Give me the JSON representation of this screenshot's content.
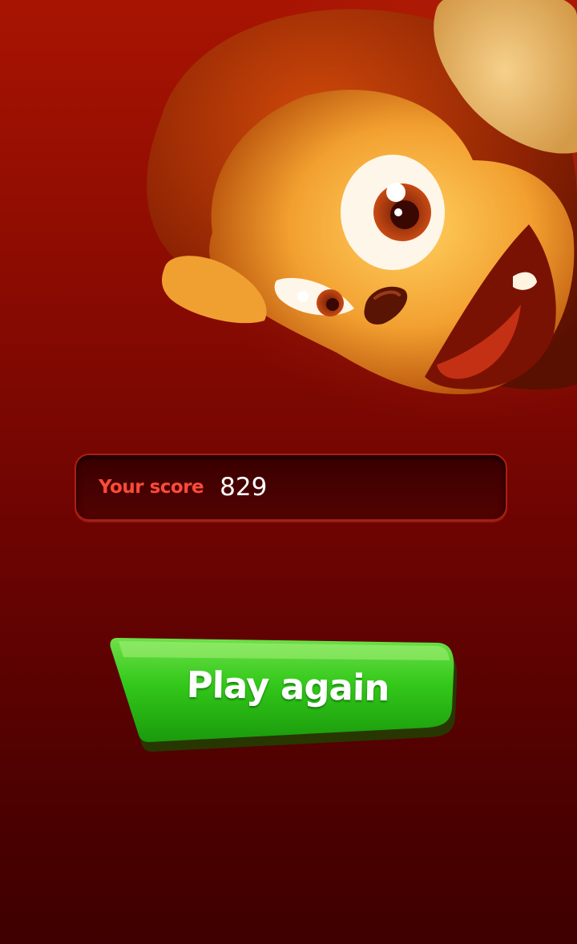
{
  "score": {
    "label": "Your score",
    "value": "829"
  },
  "actions": {
    "play_again_label": "Play again"
  },
  "mascot": {
    "icon": "monkey-mascot-icon"
  },
  "colors": {
    "background_top": "#a81402",
    "background_bottom": "#3e0000",
    "score_label": "#ff4a3a",
    "button_green": "#33c81a",
    "mascot_fur": "#f0a232"
  }
}
